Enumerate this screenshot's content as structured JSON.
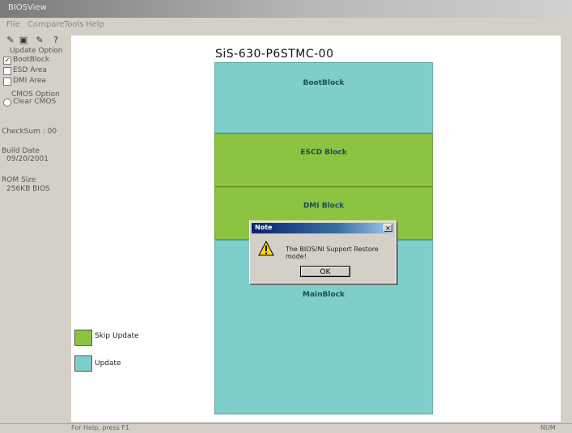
{
  "window": {
    "title": "BIOSView"
  },
  "menu": [
    "File",
    "Compare",
    "Tools",
    "Help"
  ],
  "toolbar": {
    "icons": [
      "open-icon",
      "save-icon",
      "edit-icon",
      "help-icon"
    ],
    "glyphs": [
      "✎",
      "▣",
      "✎",
      "?"
    ]
  },
  "left_panel": {
    "update_option_label": "Update Option",
    "options": [
      {
        "label": "BootBlock",
        "checked": true
      },
      {
        "label": "ESD Area",
        "checked": false
      },
      {
        "label": "DMI Area",
        "checked": false
      }
    ],
    "cmos_option": "CMOS Option",
    "clear_cmos": "Clear CMOS",
    "checksum_label": "CheckSum : 00",
    "build_date_label": "Build Date",
    "build_date_value": "09/20/2001",
    "rom_size_label": "ROM Size",
    "rom_size_value": "256KB BIOS"
  },
  "chip": {
    "title": "SiS-630-P6STMC-00",
    "blocks": [
      {
        "label": "BootBlock",
        "status": "update"
      },
      {
        "label": "ESCD Block",
        "status": "skip"
      },
      {
        "label": "DMI Block",
        "status": "skip"
      },
      {
        "label": "MainBlock",
        "status": "update"
      }
    ]
  },
  "legend": {
    "items": [
      {
        "label": "Skip Update",
        "color": "#8cc340"
      },
      {
        "label": "Update",
        "color": "#7ecfcb"
      }
    ]
  },
  "dialog": {
    "title": "Note",
    "message": "The BIOS/NI Support Restore mode!",
    "ok_label": "OK"
  },
  "statusbar": {
    "left": "For Help, press F1",
    "right": "NUM"
  },
  "colors": {
    "update": "#7ecfcb",
    "skip": "#8cc340",
    "dialog_title": "#0a246a"
  }
}
